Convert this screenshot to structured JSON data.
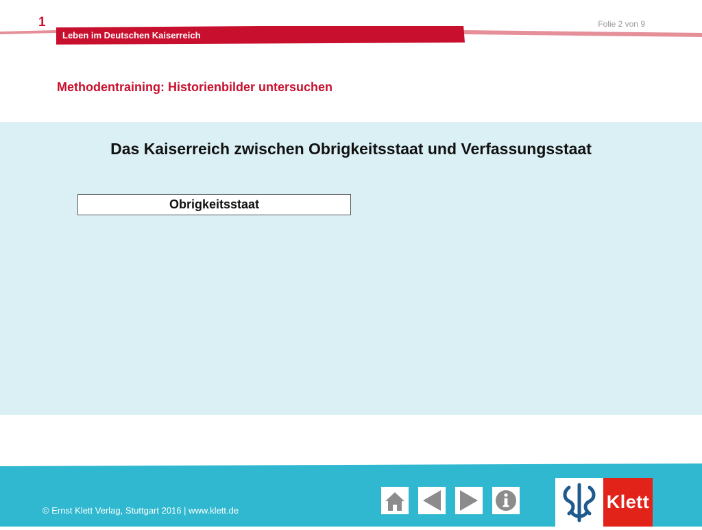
{
  "header": {
    "chapter_number": "1",
    "chapter_title": "Leben im Deutschen Kaiserreich",
    "slide_counter": "Folie 2 von 9",
    "subtitle": "Methodentraining: Historienbilder untersuchen"
  },
  "main": {
    "title": "Das Kaiserreich zwischen Obrigkeitsstaat und Verfassungsstaat",
    "term_box": "Obrigkeitsstaat"
  },
  "footer": {
    "copyright": "© Ernst Klett Verlag, Stuttgart 2016 | www.klett.de",
    "nav_buttons": [
      "home-icon",
      "arrow-left-icon",
      "arrow-right-icon",
      "info-icon"
    ],
    "logo_text": "Klett"
  },
  "colors": {
    "accent_red": "#c8102e",
    "panel_blue": "#dbf0f5",
    "footer_teal": "#2fb8cf",
    "nav_gray": "#8c8c8c",
    "logo_red": "#e2231a"
  }
}
